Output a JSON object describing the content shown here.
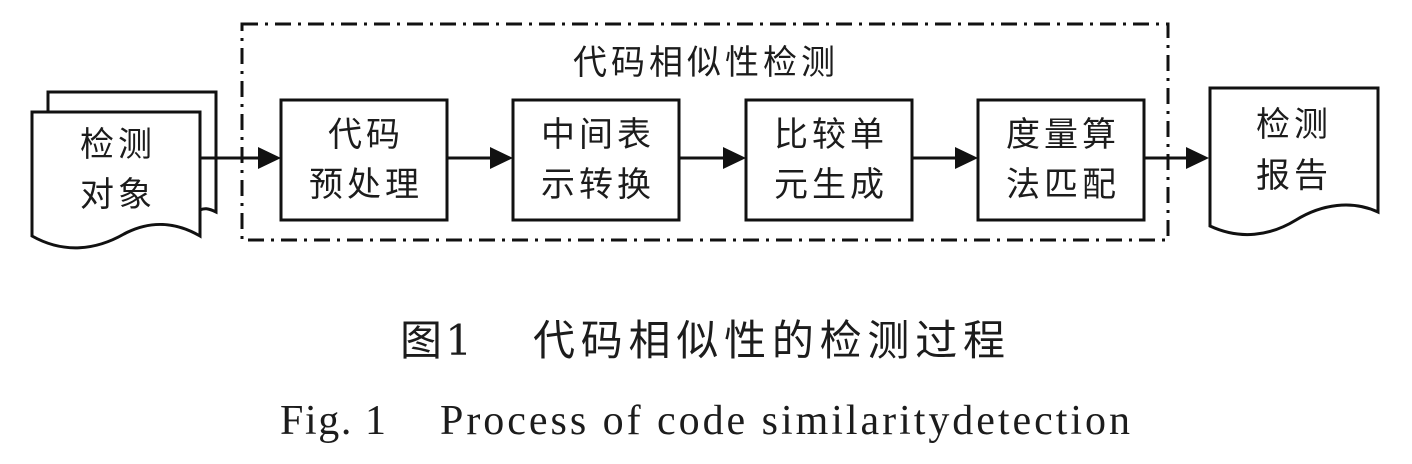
{
  "diagram": {
    "group_title": "代码相似性检测",
    "input_doc": {
      "lines": [
        "检测",
        "对象"
      ]
    },
    "steps": [
      {
        "lines": [
          "代码",
          "预处理"
        ]
      },
      {
        "lines": [
          "中间表",
          "示转换"
        ]
      },
      {
        "lines": [
          "比较单",
          "元生成"
        ]
      },
      {
        "lines": [
          "度量算",
          "法匹配"
        ]
      }
    ],
    "output_doc": {
      "lines": [
        "检测",
        "报告"
      ]
    }
  },
  "caption": {
    "cn_label": "图 1",
    "cn_title": "代码相似性的检测过程",
    "en_label": "Fig. 1",
    "en_title": "Process of code similaritydetection"
  }
}
